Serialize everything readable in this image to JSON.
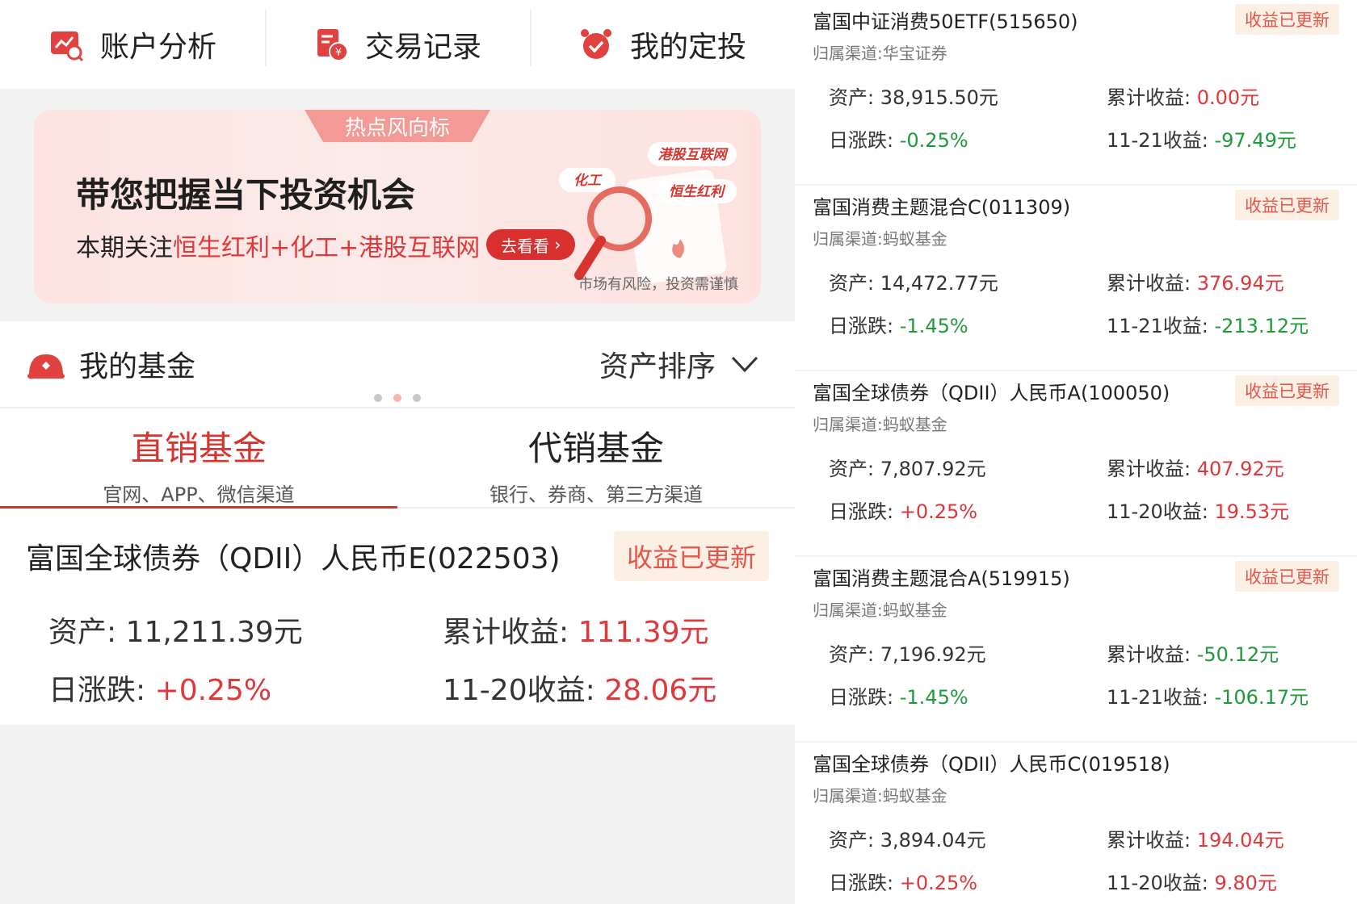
{
  "nav": {
    "items": [
      {
        "label": "账户分析",
        "icon": "chart-icon"
      },
      {
        "label": "交易记录",
        "icon": "receipt-icon"
      },
      {
        "label": "我的定投",
        "icon": "alarm-clock-icon"
      }
    ]
  },
  "banner": {
    "tag": "热点风向标",
    "headline": "带您把握当下投资机会",
    "sub_prefix": "本期关注",
    "sub_highlight": "恒生红利+化工+港股互联网",
    "button": "去看看",
    "disclaimer": "市场有风险，投资需谨慎",
    "art_labels": [
      "港股互联网",
      "化工",
      "恒生红利"
    ]
  },
  "myfund": {
    "title": "我的基金",
    "sort": "资产排序"
  },
  "tabs": [
    {
      "title": "直销基金",
      "sub": "官网、APP、微信渠道"
    },
    {
      "title": "代销基金",
      "sub": "银行、券商、第三方渠道"
    }
  ],
  "direct_fund": {
    "name": "富国全球债券（QDII）人民币E(022503)",
    "badge": "收益已更新",
    "asset_label": "资产:",
    "asset": "11,211.39元",
    "cum_label": "累计收益:",
    "cum": "111.39元",
    "daily_label": "日涨跌:",
    "daily": "+0.25%",
    "day_label": "11-20收益:",
    "day": "28.06元"
  },
  "funds": [
    {
      "name": "富国中证消费50ETF(515650)",
      "badge": "收益已更新",
      "channel": "归属渠道:华宝证券",
      "asset": "38,915.50元",
      "cum": "0.00元",
      "daily": "-0.25%",
      "day_label": "11-21收益:",
      "day": "-97.49元"
    },
    {
      "name": "富国消费主题混合C(011309)",
      "badge": "收益已更新",
      "channel": "归属渠道:蚂蚁基金",
      "asset": "14,472.77元",
      "cum": "376.94元",
      "daily": "-1.45%",
      "day_label": "11-21收益:",
      "day": "-213.12元"
    },
    {
      "name": "富国全球债券（QDII）人民币A(100050)",
      "badge": "收益已更新",
      "channel": "归属渠道:蚂蚁基金",
      "asset": "7,807.92元",
      "cum": "407.92元",
      "daily": "+0.25%",
      "day_label": "11-20收益:",
      "day": "19.53元"
    },
    {
      "name": "富国消费主题混合A(519915)",
      "badge": "收益已更新",
      "channel": "归属渠道:蚂蚁基金",
      "asset": "7,196.92元",
      "cum": "-50.12元",
      "daily": "-1.45%",
      "day_label": "11-21收益:",
      "day": "-106.17元"
    },
    {
      "name": "富国全球债券（QDII）人民币C(019518)",
      "badge": "",
      "channel": "归属渠道:蚂蚁基金",
      "asset": "3,894.04元",
      "cum": "194.04元",
      "daily": "+0.25%",
      "day_label": "11-20收益:",
      "day": "9.80元"
    }
  ],
  "labels": {
    "asset": "资产:",
    "cum": "累计收益:",
    "daily": "日涨跌:"
  },
  "colors": {
    "accent": "#d8342f",
    "up": "#e0373b",
    "down": "#1f9a3b",
    "badge_bg": "#fcefe3"
  }
}
